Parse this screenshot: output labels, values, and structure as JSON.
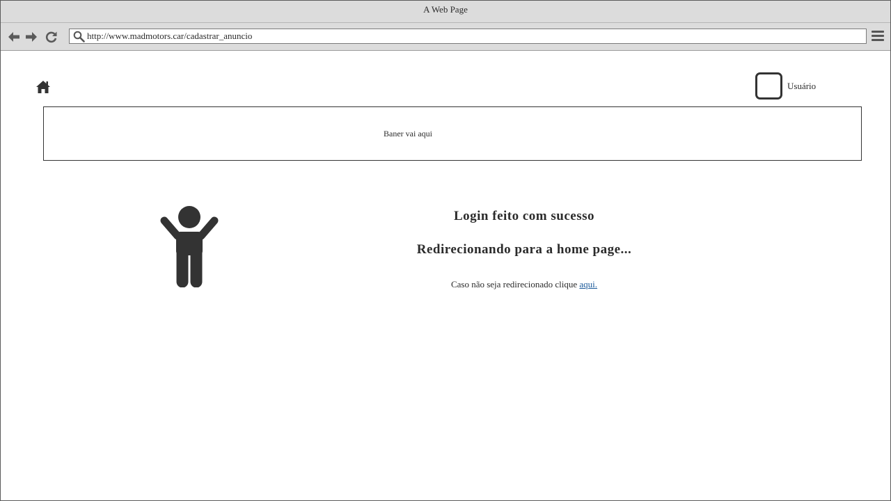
{
  "window": {
    "title": "A Web Page"
  },
  "browser": {
    "url": "http://www.madmotors.car/cadastrar_anuncio",
    "back_icon": "arrow-left-icon",
    "forward_icon": "arrow-right-icon",
    "reload_icon": "reload-icon",
    "search_icon": "search-icon",
    "menu_icon": "hamburger-menu-icon"
  },
  "header": {
    "home_icon": "home-icon",
    "user_label": "Usuário"
  },
  "banner": {
    "text": "Baner vai aqui"
  },
  "main": {
    "illustration_icon": "person-arms-raised-icon",
    "title1": "Login feito com sucesso",
    "title2": "Redirecionando para a home page...",
    "redirect_text": "Caso não seja redirecionado clique",
    "redirect_link": "aqui."
  },
  "colors": {
    "chrome": "#dcdcdc",
    "icon": "#333333",
    "link": "#1b5a9a"
  }
}
